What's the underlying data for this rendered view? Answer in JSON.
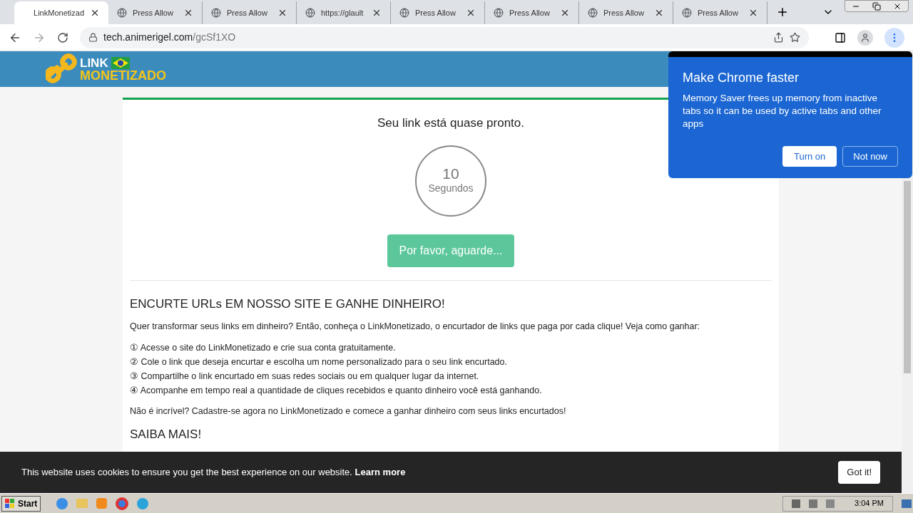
{
  "tabs": [
    {
      "title": "LinkMonetizad",
      "selected": true,
      "icon": false
    },
    {
      "title": "Press Allow",
      "selected": false,
      "icon": true
    },
    {
      "title": "Press Allow",
      "selected": false,
      "icon": true
    },
    {
      "title": "https://glault",
      "selected": false,
      "icon": true
    },
    {
      "title": "Press Allow",
      "selected": false,
      "icon": true
    },
    {
      "title": "Press Allow",
      "selected": false,
      "icon": true
    },
    {
      "title": "Press Allow",
      "selected": false,
      "icon": true
    },
    {
      "title": "Press Allow",
      "selected": false,
      "icon": true
    }
  ],
  "address": {
    "domain": "tech.animerigel.com",
    "path": "/gcSf1XO"
  },
  "logo": {
    "line1": "LINK",
    "line2": "MONETIZADO"
  },
  "card": {
    "heading": "Seu link está quase pronto.",
    "count": "10",
    "unit": "Segundos",
    "button": "Por favor, aguarde..."
  },
  "article": {
    "title": "ENCURTE URLs EM NOSSO SITE E GANHE DINHEIRO!",
    "intro": "Quer transformar seus links em dinheiro? Então, conheça o LinkMonetizado, o encurtador de links que paga por cada clique! Veja como ganhar:",
    "steps": [
      "① Acesse o site do LinkMonetizado e crie sua conta gratuitamente.",
      "② Cole o link que deseja encurtar e escolha um nome personalizado para o seu link encurtado.",
      "③ Compartilhe o link encurtado em suas redes sociais ou em qualquer lugar da internet.",
      "④ Acompanhe em tempo real a quantidade de cliques recebidos e quanto dinheiro você está ganhando."
    ],
    "outro": "Não é incrível? Cadastre-se agora no LinkMonetizado e comece a ganhar dinheiro com seus links encurtados!",
    "subtitle": "SAIBA MAIS!"
  },
  "popup": {
    "title": "Make Chrome faster",
    "body": "Memory Saver frees up memory from inactive tabs so it can be used by active tabs and other apps",
    "primary": "Turn on",
    "secondary": "Not now"
  },
  "cookie": {
    "text": "This website uses cookies to ensure you get the best experience on our website.",
    "link": "Learn more",
    "button": "Got it!"
  },
  "taskbar": {
    "start": "Start",
    "time": "3:04 PM"
  }
}
